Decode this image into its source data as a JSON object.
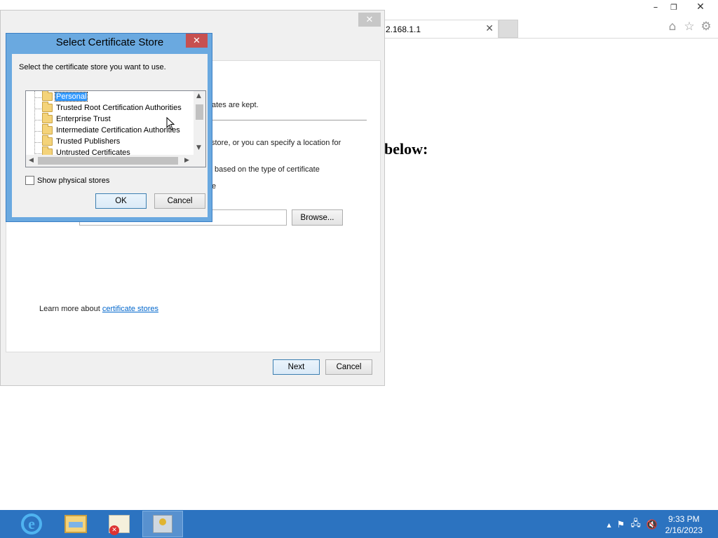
{
  "browser": {
    "tab_title": "2.168.1.1",
    "tab_close_glyph": "✕",
    "window_buttons": {
      "minimize": "–",
      "restore": "❐",
      "close": "✕"
    },
    "toolbar_icons": [
      "home-icon",
      "favorites-star-icon",
      "tools-gear-icon"
    ],
    "toolbar_glyphs": {
      "home": "⌂",
      "star": "☆",
      "gear": "⚙"
    },
    "page_heading": "below:"
  },
  "wizard": {
    "close_glyph": "✕",
    "text_kept": "ficates are kept.",
    "text_store": "store, or you can specify a location for",
    "text_type": "based on the type of certificate",
    "text_e": "e",
    "browse_label": "Browse...",
    "learn_more_prefix": "Learn more about ",
    "learn_more_link": "certificate stores",
    "next_label": "Next",
    "cancel_label": "Cancel"
  },
  "dialog": {
    "title": "Select Certificate Store",
    "close_glyph": "✕",
    "instruction": "Select the certificate store you want to use.",
    "stores": [
      {
        "label": "Personal",
        "selected": true
      },
      {
        "label": "Trusted Root Certification Authorities",
        "selected": false
      },
      {
        "label": "Enterprise Trust",
        "selected": false
      },
      {
        "label": "Intermediate Certification Authorities",
        "selected": false
      },
      {
        "label": "Trusted Publishers",
        "selected": false
      },
      {
        "label": "Untrusted Certificates",
        "selected": false
      }
    ],
    "show_physical_label": "Show physical stores",
    "show_physical_checked": false,
    "ok_label": "OK",
    "cancel_label": "Cancel"
  },
  "taskbar": {
    "apps": [
      "internet-explorer",
      "file-explorer",
      "certificate-manager",
      "certificate-import-wizard"
    ],
    "ie_glyph": "e",
    "tray_glyphs": {
      "chevron": "▲",
      "flag": "⚑",
      "network": "🖧",
      "volume": "🔇"
    },
    "time": "9:33 PM",
    "date": "2/16/2023"
  },
  "colors": {
    "dialog_frame": "#6aa9e0",
    "dialog_close": "#c75050",
    "selection": "#3399ff",
    "taskbar": "#2c73c0",
    "link": "#0066cc"
  }
}
